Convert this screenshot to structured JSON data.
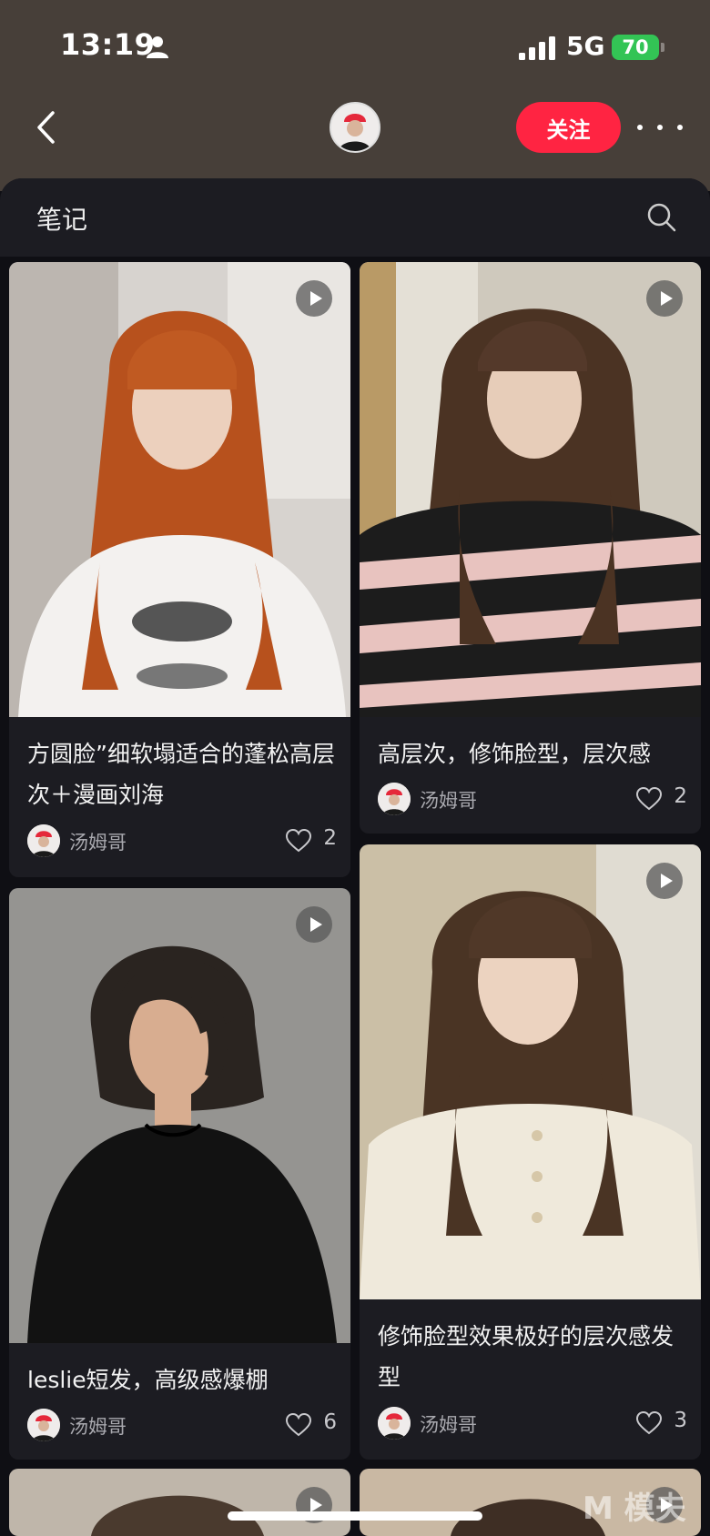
{
  "status_bar": {
    "time": "13:19",
    "network": "5G",
    "battery": "70"
  },
  "nav": {
    "follow_label": "关注"
  },
  "section": {
    "title": "笔记"
  },
  "notes": [
    {
      "title": "方圆脸”细软塌适合的蓬松高层次＋漫画刘海",
      "author": "汤姆哥",
      "likes": "2"
    },
    {
      "title": "高层次，修饰脸型，层次感",
      "author": "汤姆哥",
      "likes": "2"
    },
    {
      "title": "leslie短发，高级感爆棚",
      "author": "汤姆哥",
      "likes": "6"
    },
    {
      "title": "修饰脸型效果极好的层次感发型",
      "author": "汤姆哥",
      "likes": "3"
    }
  ],
  "watermark": "M 模夫",
  "icons": [
    "person-icon",
    "signal-icon",
    "back-icon",
    "avatar",
    "more-icon",
    "search-icon",
    "play-icon",
    "heart-icon"
  ],
  "colors": {
    "header": "#473f39",
    "follow": "#ff2442",
    "background": "#0f0f14",
    "card": "#1c1c22"
  }
}
